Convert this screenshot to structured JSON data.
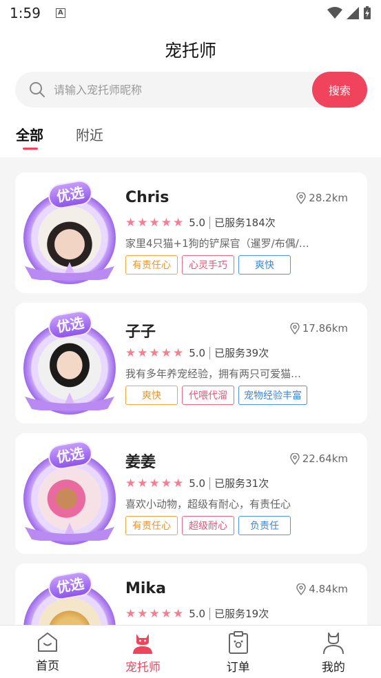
{
  "status": {
    "time": "1:59"
  },
  "header": {
    "title": "宠托师",
    "search_placeholder": "请输入宠托师昵称",
    "search_button": "搜索",
    "tabs": [
      {
        "label": "全部"
      },
      {
        "label": "附近"
      }
    ]
  },
  "badge_text": "优选",
  "sitters": [
    {
      "name": "Chris",
      "distance": "28.2km",
      "score": "5.0",
      "served": "已服务184次",
      "rating": 5,
      "desc": "家里4只猫+1狗的铲屎官（暹罗/布偶/…",
      "tags": [
        "有责任心",
        "心灵手巧",
        "爽快"
      ]
    },
    {
      "name": "子子",
      "distance": "17.86km",
      "score": "5.0",
      "served": "已服务39次",
      "rating": 5,
      "desc": "我有多年养宠经验，拥有两只可爱猫…",
      "tags": [
        "爽快",
        "代喂代溜",
        "宠物经验丰富"
      ]
    },
    {
      "name": "姜姜",
      "distance": "22.64km",
      "score": "5.0",
      "served": "已服务31次",
      "rating": 5,
      "desc": "喜欢小动物，超级有耐心，有责任心",
      "tags": [
        "有责任心",
        "超级耐心",
        "负责任"
      ]
    },
    {
      "name": "Mika",
      "distance": "4.84km",
      "score": "5.0",
      "served": "已服务19次",
      "rating": 5,
      "desc": "",
      "tags": []
    }
  ],
  "tabbar": [
    {
      "label": "首页",
      "icon": "home-icon"
    },
    {
      "label": "宠托师",
      "icon": "sitter-icon",
      "active": true
    },
    {
      "label": "订单",
      "icon": "order-icon"
    },
    {
      "label": "我的",
      "icon": "profile-icon"
    }
  ],
  "colors": {
    "accent": "#f0445d",
    "tag_orange": "#f4a63a",
    "tag_pink": "#e86a86",
    "tag_blue": "#4a95e6",
    "star": "#f57e8f",
    "badge_purple": "#9e6ae8"
  }
}
